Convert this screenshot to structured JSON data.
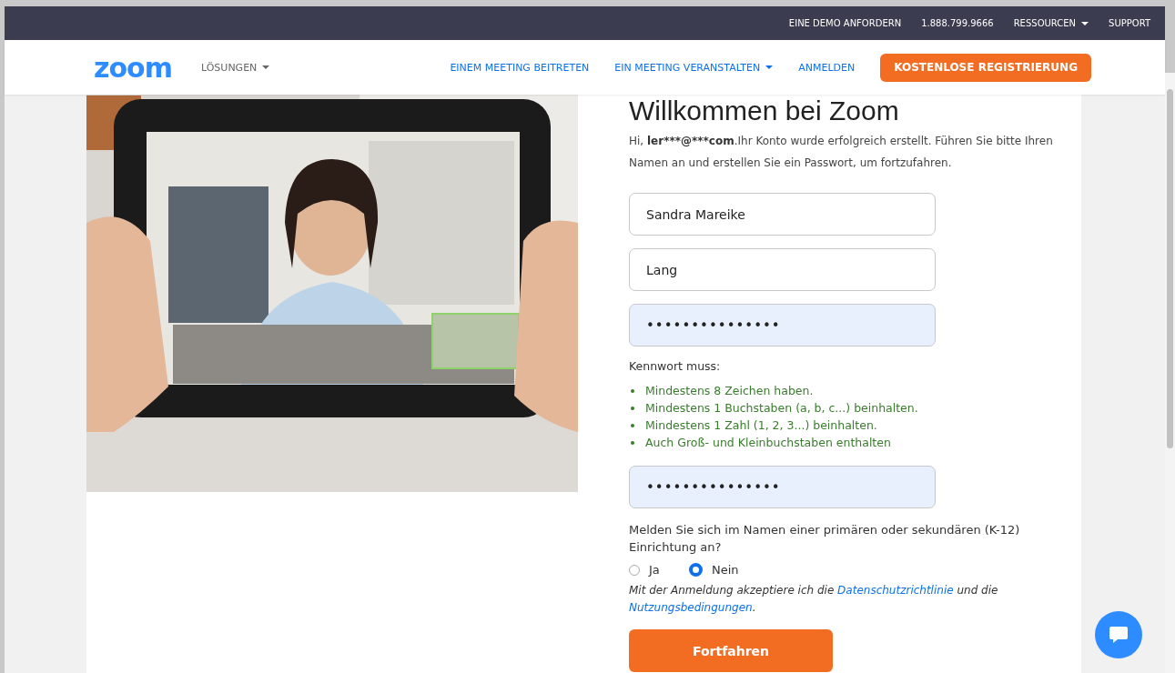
{
  "top_bar": {
    "links": [
      {
        "label": "EINE DEMO ANFORDERN",
        "dropdown": false
      },
      {
        "label": "1.888.799.9666",
        "dropdown": false
      },
      {
        "label": "RESSOURCEN",
        "dropdown": true
      },
      {
        "label": "SUPPORT",
        "dropdown": false
      }
    ]
  },
  "nav": {
    "logo": "zoom",
    "solutions": "LÖSUNGEN",
    "links": [
      {
        "label": "EINEM MEETING BEITRETEN",
        "dropdown": false
      },
      {
        "label": "EIN MEETING VERANSTALTEN",
        "dropdown": true
      },
      {
        "label": "ANMELDEN",
        "dropdown": false
      }
    ],
    "cta": "KOSTENLOSE REGISTRIERUNG"
  },
  "form": {
    "title": "Willkommen bei Zoom",
    "intro": {
      "greeting": "Hi,",
      "email": "ler***@***com",
      "text": ".Ihr Konto wurde erfolgreich erstellt. Führen Sie bitte Ihren Namen an und erstellen Sie ein Passwort, um fortzufahren."
    },
    "fields": [
      {
        "kind": "text",
        "value": "Sandra Mareike"
      },
      {
        "kind": "text",
        "value": "Lang"
      },
      {
        "kind": "password",
        "value": "•••••••••••••••"
      }
    ],
    "rules_title": "Kennwort muss:",
    "rules": [
      "Mindestens 8 Zeichen haben.",
      "Mindestens 1 Buchstaben (a, b, c...) beinhalten.",
      "Mindestens 1 Zahl (1, 2, 3...) beinhalten.",
      "Auch Groß- und Kleinbuchstaben enthalten"
    ],
    "confirm_field": {
      "kind": "password",
      "value": "•••••••••••••••"
    },
    "question": "Melden Sie sich im Namen einer primären oder sekundären (K-12) Einrichtung an?",
    "options": [
      {
        "label": "Ja",
        "selected": false
      },
      {
        "label": "Nein",
        "selected": true
      }
    ],
    "terms": {
      "before": "Mit der Anmeldung akzeptiere ich die",
      "link1": "Datenschutzrichtlinie",
      "middle": "und die",
      "link2": "Nutzungsbedingungen",
      "after": "."
    },
    "submit": "Fortfahren"
  }
}
